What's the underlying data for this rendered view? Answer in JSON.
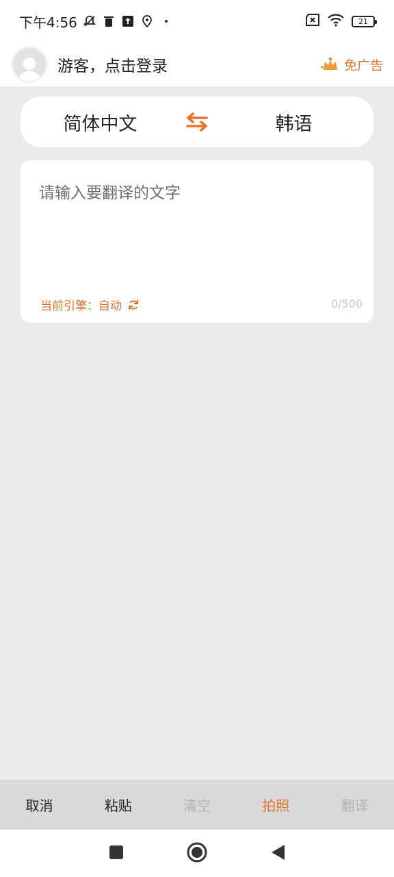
{
  "status": {
    "time": "下午4:56",
    "battery": "21",
    "icons": [
      "bell-mute-icon",
      "trash-icon",
      "upload-icon",
      "location-icon",
      "dot-icon",
      "sim-x-icon",
      "wifi-icon",
      "battery-icon"
    ]
  },
  "header": {
    "login_text": "游客，点击登录",
    "noad_label": "免广告"
  },
  "lang": {
    "source": "简体中文",
    "target": "韩语"
  },
  "input": {
    "placeholder": "请输入要翻译的文字",
    "engine": "当前引擎：自动",
    "count": "0/500"
  },
  "toolbar": {
    "cancel": "取消",
    "paste": "粘贴",
    "clear": "清空",
    "photo": "拍照",
    "translate": "翻译"
  },
  "colors": {
    "accent": "#e8722a",
    "background": "#ebebeb",
    "toolbar": "#d9d9d9"
  }
}
